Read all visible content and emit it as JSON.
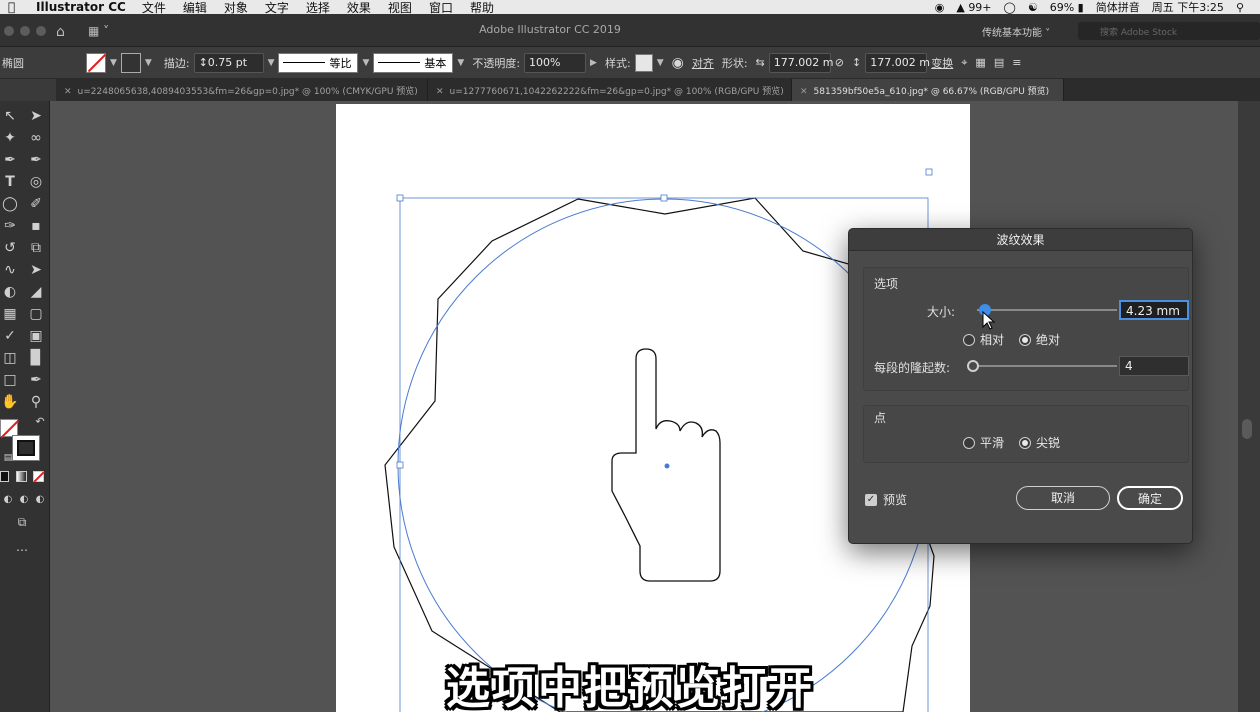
{
  "menubar": {
    "app_name": "Illustrator CC",
    "items": [
      "文件",
      "编辑",
      "对象",
      "文字",
      "选择",
      "效果",
      "视图",
      "窗口",
      "帮助"
    ],
    "status": {
      "notifications": "99+",
      "battery": "69%",
      "input_method": "简体拼音",
      "clock": "周五 下午3:25"
    }
  },
  "titlebar": {
    "title": "Adobe Illustrator CC 2019",
    "workspace": "传统基本功能",
    "stock_placeholder": "搜索 Adobe Stock"
  },
  "controlbar": {
    "object_type": "椭圆",
    "stroke_label": "描边:",
    "stroke_weight": "0.75 pt",
    "line_profile": "等比",
    "brush": "基本",
    "opacity_label": "不透明度:",
    "opacity": "100%",
    "style_label": "样式:",
    "align_label": "对齐",
    "shape_label": "形状:",
    "width": "177.002 m",
    "height": "177.002 m",
    "transform_label": "变换"
  },
  "tabs": [
    {
      "label": "u=2248065638,4089403553&fm=26&gp=0.jpg* @ 100% (CMYK/GPU 预览)",
      "active": false
    },
    {
      "label": "u=1277760671,1042262222&fm=26&gp=0.jpg* @ 100% (RGB/GPU 预览)",
      "active": false
    },
    {
      "label": "581359bf50e5a_610.jpg* @ 66.67% (RGB/GPU 预览)",
      "active": true
    }
  ],
  "dialog": {
    "title": "波纹效果",
    "options_section": "选项",
    "size_label": "大小:",
    "size_value": "4.23 mm",
    "relative_label": "相对",
    "absolute_label": "绝对",
    "ridges_label": "每段的隆起数:",
    "ridges_value": "4",
    "points_section": "点",
    "smooth_label": "平滑",
    "corner_label": "尖锐",
    "preview_label": "预览",
    "cancel_label": "取消",
    "ok_label": "确定",
    "size_mode": "absolute",
    "point_mode": "corner",
    "preview_checked": true
  },
  "subtitle": "选项中把预览打开",
  "colors": {
    "selection": "#4a7bd0",
    "accent": "#3d8ee8",
    "dialog_bg": "#4a4a4a"
  }
}
